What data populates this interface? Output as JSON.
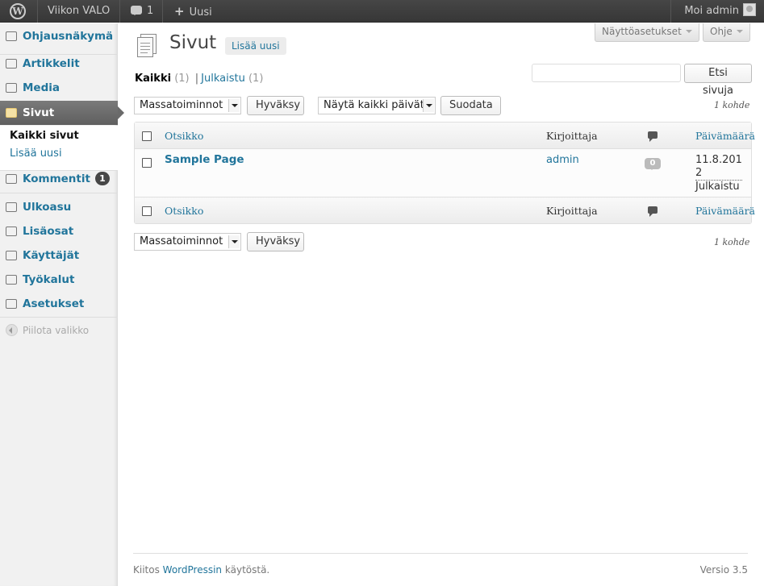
{
  "admin_bar": {
    "site_name": "Viikon VALO",
    "comments_count": "1",
    "new_label": "Uusi",
    "account_greeting": "Moi admin"
  },
  "sidebar": {
    "items": [
      {
        "label": "Ohjausnäkymä",
        "icon": "dashboard-icon"
      },
      {
        "label": "Artikkelit",
        "icon": "pin-icon"
      },
      {
        "label": "Media",
        "icon": "media-icon"
      },
      {
        "label": "Sivut",
        "icon": "pages-icon",
        "current": true
      },
      {
        "label": "Kommentit",
        "icon": "comments-icon",
        "badge": "1"
      },
      {
        "label": "Ulkoasu",
        "icon": "appearance-icon"
      },
      {
        "label": "Lisäosat",
        "icon": "plugins-icon"
      },
      {
        "label": "Käyttäjät",
        "icon": "users-icon"
      },
      {
        "label": "Työkalut",
        "icon": "tools-icon"
      },
      {
        "label": "Asetukset",
        "icon": "settings-icon"
      }
    ],
    "submenu": {
      "all_pages": "Kaikki sivut",
      "add_new": "Lisää uusi"
    },
    "collapse_label": "Piilota valikko"
  },
  "screen_meta": {
    "screen_options": "Näyttöasetukset",
    "help": "Ohje"
  },
  "page": {
    "title": "Sivut",
    "add_new": "Lisää uusi"
  },
  "filters": {
    "all_label": "Kaikki",
    "all_count": "(1)",
    "separator": "|",
    "published_label": "Julkaistu",
    "published_count": "(1)",
    "search_button": "Etsi sivuja",
    "search_value": "",
    "bulk_actions": "Massatoiminnot",
    "apply": "Hyväksy",
    "dates_select": "Näytä kaikki päivät",
    "filter_button": "Suodata",
    "items_count": "1 kohde"
  },
  "table": {
    "columns": {
      "title": "Otsikko",
      "author": "Kirjoittaja",
      "date": "Päivämäärä"
    },
    "rows": [
      {
        "title": "Sample Page",
        "author": "admin",
        "comments": "0",
        "date_line1": "11.8.201",
        "date_line2": "2",
        "status": "Julkaistu"
      }
    ]
  },
  "footer": {
    "thanks_prefix": "Kiitos",
    "thanks_link": "WordPressin",
    "thanks_suffix": "käytöstä.",
    "version": "Versio 3.5"
  },
  "colors": {
    "link": "#21759b",
    "adminbar": "#464646",
    "current_menu": "#6a6a6a"
  }
}
